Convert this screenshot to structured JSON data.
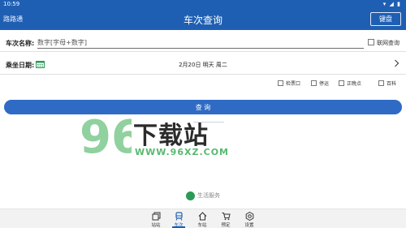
{
  "status": {
    "time": "10:59",
    "icons": "▾ ◢ ▮"
  },
  "appbar": {
    "left": "路路通",
    "title": "车次查询",
    "keyboard_btn": "键盘"
  },
  "train_no": {
    "label": "车次名称:",
    "placeholder": "数字[字母+数字]",
    "network_label": "联网查询"
  },
  "date": {
    "label": "乘坐日期:",
    "value": "2月20日 明天 周二"
  },
  "options": [
    "检票口",
    "停运",
    "正晚点",
    "百科"
  ],
  "query_btn": "查 询",
  "watermark": {
    "brand": "下载站",
    "digits": "96",
    "url": "WWW.96XZ.COM"
  },
  "life_service": "生活服务",
  "tabs": [
    {
      "label": "站站",
      "icon": "pages-icon"
    },
    {
      "label": "车次",
      "icon": "train-icon"
    },
    {
      "label": "车站",
      "icon": "home-icon"
    },
    {
      "label": "预定",
      "icon": "cart-icon"
    },
    {
      "label": "设置",
      "icon": "gear-icon"
    }
  ],
  "colors": {
    "primary": "#1f5fb3",
    "button": "#2f6bc4",
    "green": "#58b96f"
  }
}
